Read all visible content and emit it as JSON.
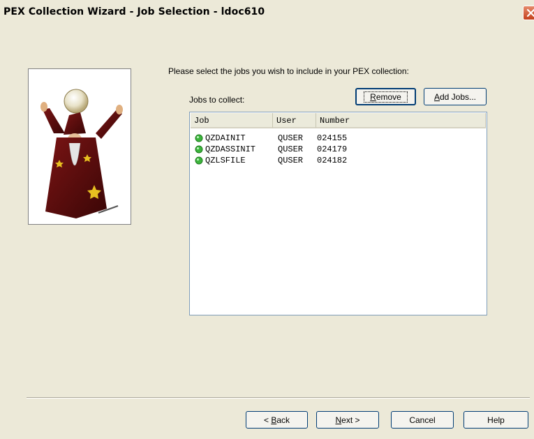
{
  "window": {
    "title": "PEX Collection Wizard - Job Selection - ldoc610"
  },
  "prompt": "Please select the jobs you wish to include in your PEX collection:",
  "jobs_label": "Jobs to collect:",
  "buttons": {
    "remove": {
      "mnemonic": "R",
      "rest": "emove"
    },
    "add_jobs": {
      "mnemonic": "A",
      "rest": "dd Jobs..."
    },
    "back": {
      "prefix": "< ",
      "mnemonic": "B",
      "rest": "ack"
    },
    "next": {
      "mnemonic": "N",
      "rest": "ext >"
    },
    "cancel": "Cancel",
    "help": "Help"
  },
  "table": {
    "columns": [
      "Job",
      "User",
      "Number"
    ],
    "rows": [
      {
        "job": "QZDAINIT",
        "user": "QUSER",
        "number": "024155",
        "status": "active"
      },
      {
        "job": "QZDASSINIT",
        "user": "QUSER",
        "number": "024179",
        "status": "active"
      },
      {
        "job": "QZLSFILE",
        "user": "QUSER",
        "number": "024182",
        "status": "active"
      }
    ]
  },
  "icons": {
    "close": "close-icon",
    "wizard": "wizard-illustration",
    "status": "green-status-icon"
  },
  "colors": {
    "status_green": "#3cb43c",
    "close_red": "#d4502a",
    "dialog_bg": "#ece9d8"
  }
}
